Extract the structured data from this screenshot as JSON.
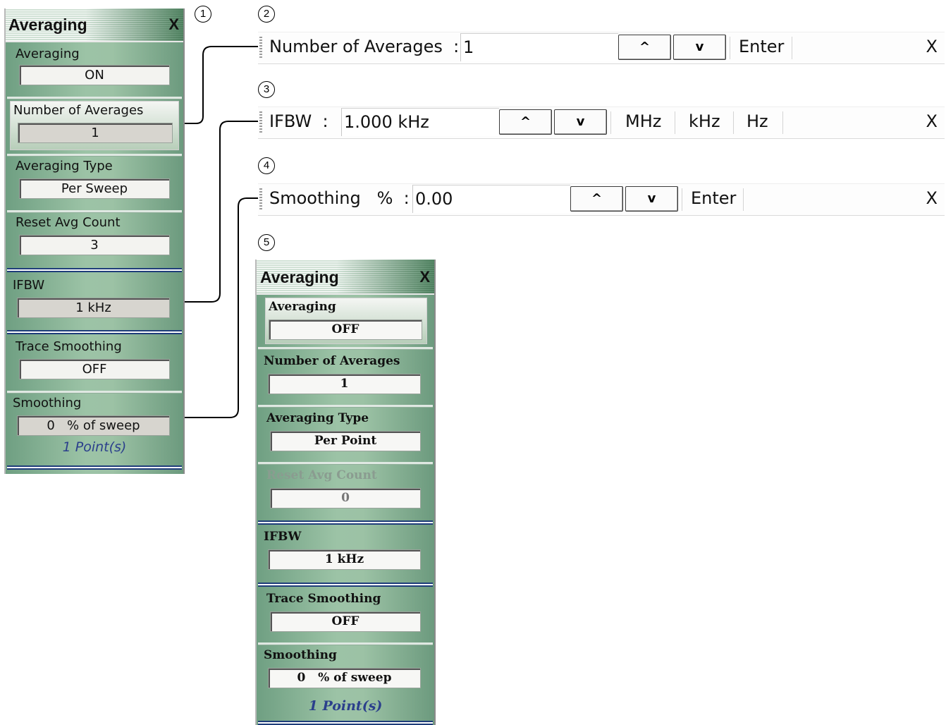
{
  "callouts": [
    "1",
    "2",
    "3",
    "4",
    "5"
  ],
  "panel1": {
    "title": "Averaging",
    "close": "X",
    "averaging": {
      "label": "Averaging",
      "value": "ON"
    },
    "num_averages": {
      "label": "Number of Averages",
      "value": "1"
    },
    "averaging_type": {
      "label": "Averaging Type",
      "value": "Per Sweep"
    },
    "reset_avg_count": {
      "label": "Reset Avg Count",
      "value": "3"
    },
    "ifbw": {
      "label": "IFBW",
      "value": "1 kHz"
    },
    "trace_smoothing": {
      "label": "Trace Smoothing",
      "value": "OFF"
    },
    "smoothing": {
      "label": "Smoothing",
      "value": "0   % of sweep",
      "note": "1 Point(s)"
    }
  },
  "toolbar_averages": {
    "label": "Number of Averages  :",
    "value": "1",
    "up": "^",
    "down": "v",
    "enter": "Enter",
    "close": "X"
  },
  "toolbar_ifbw": {
    "label": "IFBW  :",
    "value": "1.000 kHz",
    "up": "^",
    "down": "v",
    "units": [
      "MHz",
      "kHz",
      "Hz"
    ],
    "close": "X"
  },
  "toolbar_smoothing": {
    "label": "Smoothing   %  :",
    "value": "0.00",
    "up": "^",
    "down": "v",
    "enter": "Enter",
    "close": "X"
  },
  "panel2": {
    "title": "Averaging",
    "close": "X",
    "averaging": {
      "label": "Averaging",
      "value": "OFF"
    },
    "num_averages": {
      "label": "Number of Averages",
      "value": "1"
    },
    "averaging_type": {
      "label": "Averaging Type",
      "value": "Per Point"
    },
    "reset_avg_count": {
      "label": "Reset Avg Count",
      "value": "0"
    },
    "ifbw": {
      "label": "IFBW",
      "value": "1 kHz"
    },
    "trace_smoothing": {
      "label": "Trace Smoothing",
      "value": "OFF"
    },
    "smoothing": {
      "label": "Smoothing",
      "value": "0   % of sweep",
      "note": "1 Point(s)"
    }
  }
}
